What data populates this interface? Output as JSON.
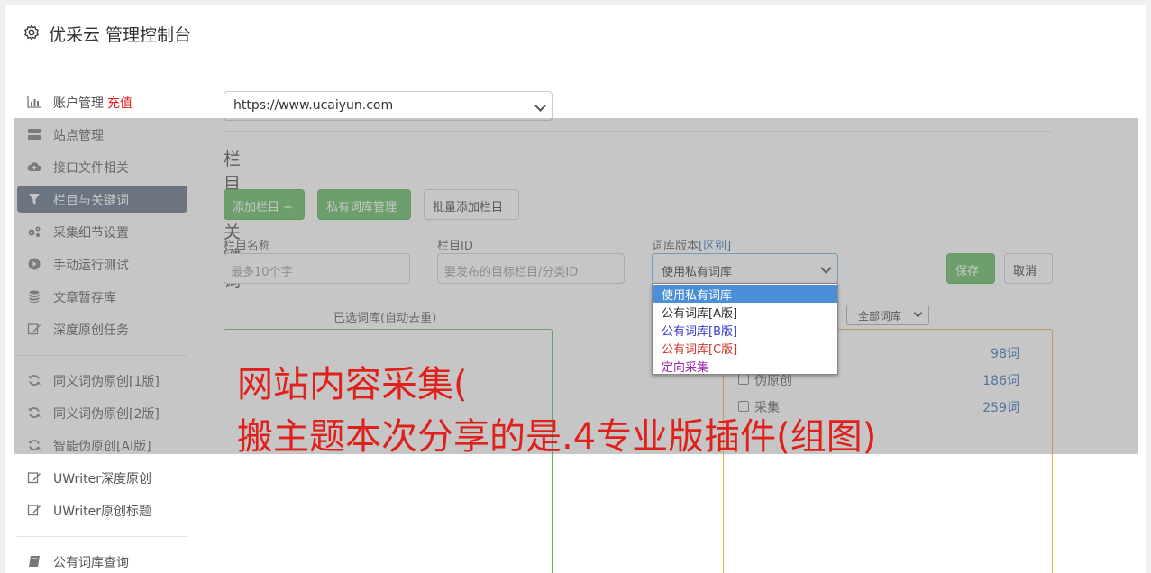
{
  "header": {
    "title": "优采云 管理控制台",
    "icon": "gear-icon"
  },
  "sidebar": {
    "items": [
      {
        "label": "账户管理",
        "badge": "充值",
        "icon": "bar-chart-icon"
      },
      {
        "label": "站点管理",
        "icon": "server-icon"
      },
      {
        "label": "接口文件相关",
        "icon": "cloud-upload-icon"
      },
      {
        "label": "栏目与关键词",
        "icon": "filter-icon",
        "active": true
      },
      {
        "label": "采集细节设置",
        "icon": "gears-icon"
      },
      {
        "label": "手动运行测试",
        "icon": "play-circle-icon"
      },
      {
        "label": "文章暂存库",
        "icon": "database-icon"
      },
      {
        "label": "深度原创任务",
        "icon": "edit-icon"
      },
      {
        "label": "同义词伪原创[1版]",
        "icon": "refresh-icon"
      },
      {
        "label": "同义词伪原创[2版]",
        "icon": "refresh-icon"
      },
      {
        "label": "智能伪原创[AI版]",
        "icon": "refresh-icon"
      },
      {
        "label": "UWriter深度原创",
        "icon": "edit-icon"
      },
      {
        "label": "UWriter原创标题",
        "icon": "edit-icon"
      },
      {
        "label": "公有词库查询",
        "icon": "book-icon"
      }
    ]
  },
  "main": {
    "site_select": "https://www.ucaiyun.com",
    "section_title": "栏目与关键词",
    "buttons": {
      "add_column": "添加栏目 +",
      "private_lib": "私有词库管理",
      "batch_add": "批量添加栏目",
      "save": "保存",
      "cancel": "取消"
    },
    "fields": {
      "column_name_label": "栏目名称",
      "column_name_placeholder": "最多10个字",
      "column_id_label": "栏目ID",
      "column_id_placeholder": "要发布的目标栏目/分类ID",
      "lib_version_label": "词库版本",
      "lib_version_link": "[区别]",
      "lib_version_value": "使用私有词库"
    },
    "selected_lib_label": "已选词库(自动去重)",
    "lib_filter": "全部词库",
    "libraries": [
      {
        "name": "",
        "count": "98词"
      },
      {
        "name": "伪原创",
        "count": "186词"
      },
      {
        "name": "采集",
        "count": "259词"
      }
    ],
    "dropdown_options": [
      {
        "label": "使用私有词库",
        "color": "#ffffff"
      },
      {
        "label": "公有词库[A版]",
        "color": "#333333"
      },
      {
        "label": "公有词库[B版]",
        "color": "#3a3ad0"
      },
      {
        "label": "公有词库[C版]",
        "color": "#d0342c"
      },
      {
        "label": "定向采集",
        "color": "#9c27b0"
      }
    ]
  },
  "caption": {
    "line1": "网站内容采集(",
    "line2": "搬主题本次分享的是.4专业版插件(组图)"
  }
}
